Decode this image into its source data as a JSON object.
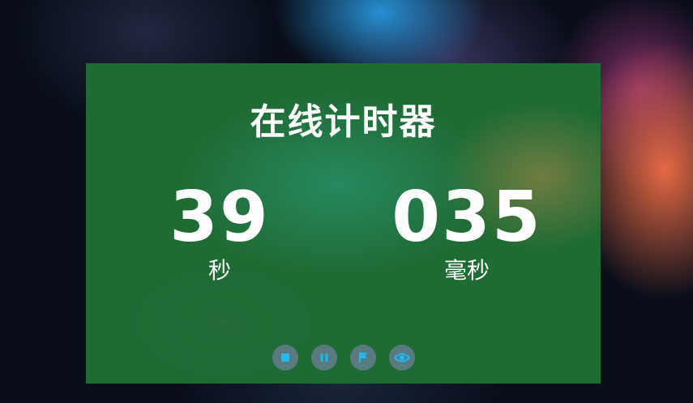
{
  "app": {
    "title": "在线计时器"
  },
  "timer": {
    "seconds_value": "39",
    "seconds_label": "秒",
    "milliseconds_value": "035",
    "milliseconds_label": "毫秒"
  },
  "controls": [
    {
      "name": "stop",
      "icon": "stop-icon"
    },
    {
      "name": "pause",
      "icon": "pause-icon"
    },
    {
      "name": "lap",
      "icon": "flag-icon"
    },
    {
      "name": "view",
      "icon": "eye-icon"
    }
  ],
  "colors": {
    "panel": "#1f6b34",
    "icon_accent": "#1fb8f0",
    "button_bg": "#5a7a82",
    "text": "#ffffff"
  }
}
